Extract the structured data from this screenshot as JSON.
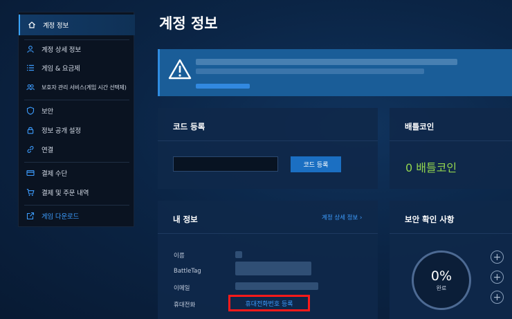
{
  "page": {
    "title": "계정 정보"
  },
  "sidebar": {
    "items": [
      {
        "label": "계정 정보",
        "icon": "home-icon"
      },
      {
        "label": "계정 상세 정보",
        "icon": "user-icon"
      },
      {
        "label": "게임 & 요금제",
        "icon": "list-icon"
      },
      {
        "label": "보호자 관리 서비스(게임 시간 선택제)",
        "icon": "users-icon"
      },
      {
        "label": "보안",
        "icon": "shield-icon"
      },
      {
        "label": "정보 공개 설정",
        "icon": "lock-icon"
      },
      {
        "label": "연결",
        "icon": "link-icon"
      },
      {
        "label": "결제 수단",
        "icon": "card-icon"
      },
      {
        "label": "결제 및 주문 내역",
        "icon": "cart-icon"
      },
      {
        "label": "게임 다운로드",
        "icon": "external-link-icon"
      }
    ]
  },
  "alert": {
    "icon": "warning-icon"
  },
  "code_panel": {
    "title": "코드 등록",
    "input_value": "",
    "button_label": "코드 등록"
  },
  "coin_panel": {
    "title": "배틀코인",
    "value": "0 배틀코인"
  },
  "info_panel": {
    "title": "내 정보",
    "detail_link": "계정 상세 정보",
    "labels": {
      "name": "이름",
      "battletag": "BattleTag",
      "email": "이메일",
      "phone": "휴대전화"
    },
    "phone_button": "휴대전화번호 등록"
  },
  "security_panel": {
    "title": "보안 확인 사항",
    "percent": "0%",
    "status": "완료"
  },
  "colors": {
    "accent": "#3d9dff",
    "coin": "#93d54f",
    "highlight": "#ff1a1a",
    "alert": "#1a5d98"
  }
}
